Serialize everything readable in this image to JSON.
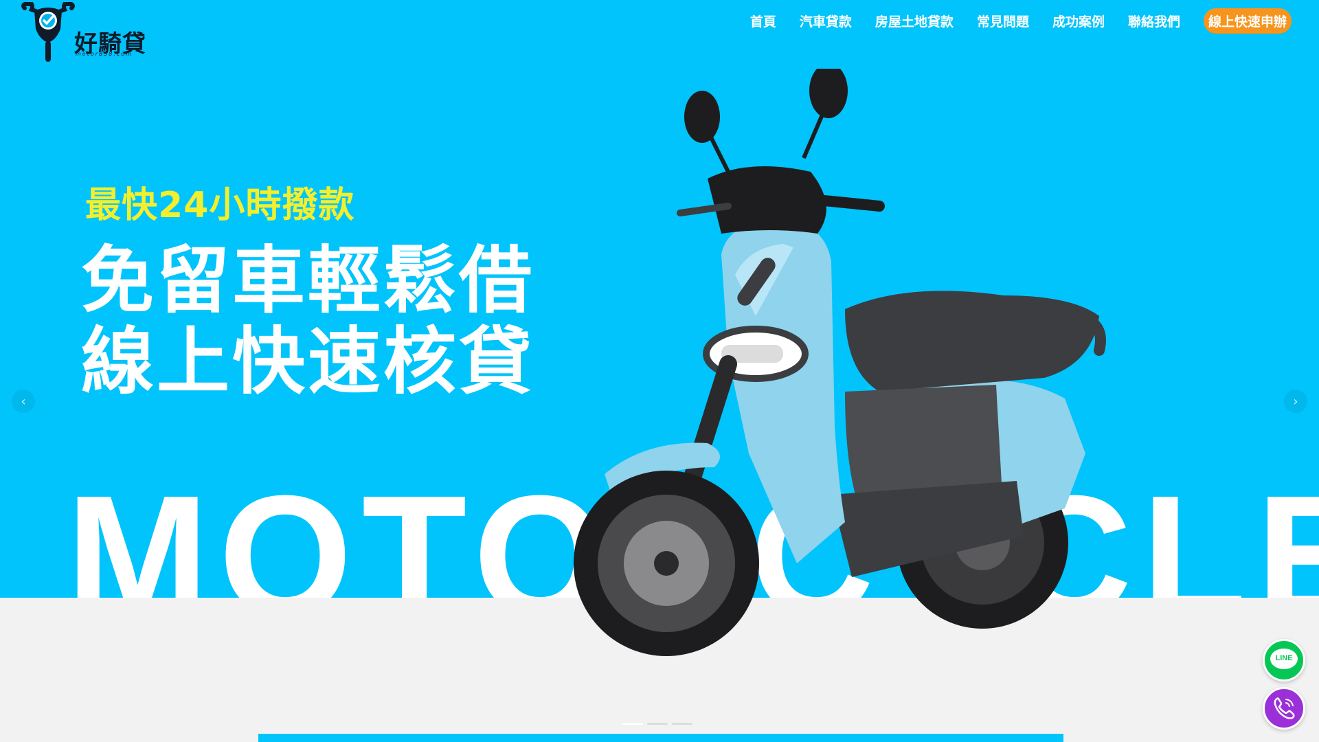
{
  "brand": {
    "logo_text": "好騎貸",
    "logo_sub": "motor838.com"
  },
  "nav": {
    "items": [
      {
        "label": "首頁"
      },
      {
        "label": "汽車貸款"
      },
      {
        "label": "房屋土地貸款"
      },
      {
        "label": "常見問題"
      },
      {
        "label": "成功案例"
      },
      {
        "label": "聯絡我們"
      }
    ],
    "cta_label": "線上快速申辦"
  },
  "hero": {
    "subheading": "最快24小時撥款",
    "headline_line1": "免留車輕鬆借",
    "headline_line2": "線上快速核貸",
    "background_word": "MOTORCYCLE"
  },
  "carousel": {
    "prev_glyph": "‹",
    "next_glyph": "›",
    "slide_count": 3,
    "active_slide": 1
  },
  "floating": {
    "line_label": "LINE"
  },
  "colors": {
    "hero_bg": "#00c4fb",
    "accent_yellow": "#f4ef2c",
    "cta_orange": "#f7941d",
    "line_green": "#06c755",
    "phone_purple": "#9b30d9",
    "scooter_body": "#8fd3ec"
  },
  "icons": {
    "logo": "scooter-helmet-check-logo",
    "phone": "phone-call-icon",
    "line": "line-chat-icon"
  }
}
